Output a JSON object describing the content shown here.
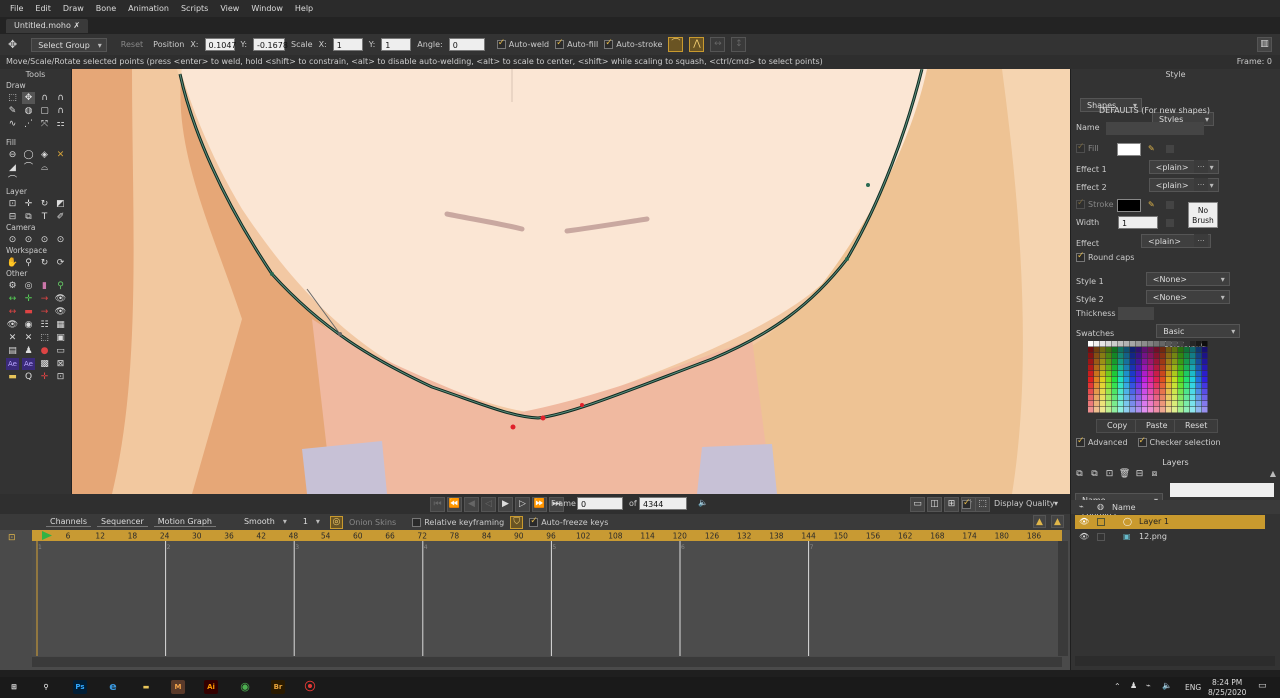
{
  "app": {
    "menu": [
      "File",
      "Edit",
      "Draw",
      "Bone",
      "Animation",
      "Scripts",
      "View",
      "Window",
      "Help"
    ],
    "document_tab": "Untitled.moho ✗"
  },
  "tool_options": {
    "mode": "Select Group",
    "reset": "Reset",
    "position_label": "Position",
    "x_label": "X:",
    "x_value": "0.1047",
    "y_label": "Y:",
    "y_value": "-0.1678",
    "scale_label": "Scale",
    "scale_x_label": "X:",
    "scale_x": "1",
    "scale_y_label": "Y:",
    "scale_y": "1",
    "angle_label": "Angle:",
    "angle": "0",
    "auto_weld": "Auto-weld",
    "auto_fill": "Auto-fill",
    "auto_stroke": "Auto-stroke"
  },
  "status": {
    "hint": "Move/Scale/Rotate selected points (press <enter> to weld, hold <shift> to constrain, <alt> to disable auto-welding, <alt> to scale to center, <shift> while scaling to squash, <ctrl/cmd> to select points)",
    "frame": "Frame: 0"
  },
  "tools_panel": {
    "title": "Tools",
    "sections": [
      "Draw",
      "Fill",
      "Layer",
      "Camera",
      "Workspace",
      "Other"
    ]
  },
  "style_panel": {
    "title": "Style",
    "shapes_tab": "Shapes",
    "styles_tab": "Styles",
    "defaults": "DEFAULTS (For new shapes)",
    "name_label": "Name",
    "fill_label": "Fill",
    "effect1_label": "Effect 1",
    "effect1_value": "<plain>",
    "effect2_label": "Effect 2",
    "effect2_value": "<plain>",
    "stroke_label": "Stroke",
    "width_label": "Width",
    "width_value": "1",
    "no_brush": "No Brush",
    "effect_label": "Effect",
    "effect_value": "<plain>",
    "round_caps": "Round caps",
    "style1_label": "Style 1",
    "style1_value": "<None>",
    "style2_label": "Style 2",
    "style2_value": "<None>",
    "thickness_label": "Thickness",
    "swatches_label": "Swatches",
    "swatches_value": "Basic Colors.png",
    "copy": "Copy",
    "paste": "Paste",
    "reset": "Reset",
    "advanced": "Advanced",
    "checker_selection": "Checker selection",
    "fill_color": "#ffffff",
    "stroke_color": "#000000"
  },
  "layers_panel": {
    "title": "Layers",
    "filter": "Name contains...",
    "name_header": "Name",
    "layers": [
      "Layer 1",
      "12.png"
    ]
  },
  "timeline_controls": {
    "frame_label": "Frame",
    "frame_value": "0",
    "of_label": "of",
    "total": "4344",
    "display_quality": "Display Quality"
  },
  "timeline": {
    "tabs": [
      "Channels",
      "Sequencer",
      "Motion Graph"
    ],
    "interp": "Smooth",
    "interp_count": "1",
    "onion_skins": "Onion Skins",
    "relative_keyframing": "Relative keyframing",
    "auto_freeze": "Auto-freeze keys",
    "ruler": [
      "6",
      "12",
      "18",
      "24",
      "30",
      "36",
      "42",
      "48",
      "54",
      "60",
      "66",
      "72",
      "78",
      "84",
      "90",
      "96",
      "102",
      "108",
      "114",
      "120",
      "126",
      "132",
      "138",
      "144",
      "150",
      "156",
      "162",
      "168",
      "174",
      "180",
      "186"
    ],
    "markers": [
      "1",
      "2",
      "3",
      "4",
      "5",
      "6",
      "7"
    ]
  },
  "taskbar": {
    "time": "8:24 PM",
    "date": "8/25/2020",
    "lang": "ENG"
  },
  "colors": {
    "accent": "#e0b64a",
    "selected_layer": "#c99a2e"
  }
}
